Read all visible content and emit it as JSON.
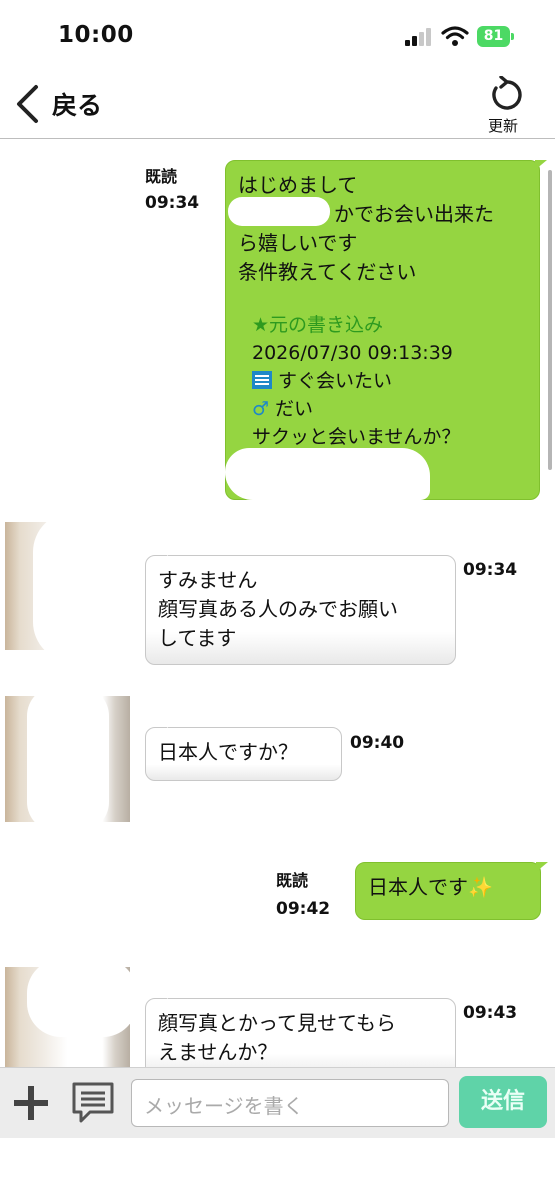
{
  "status_bar": {
    "time": "10:00",
    "battery": "81"
  },
  "nav": {
    "back_label": "戻る",
    "refresh_label": "更新"
  },
  "messages": [
    {
      "direction": "out",
      "read": "既読",
      "time": "09:34",
      "lines": [
        "はじめまして",
        "かでお会い出来た",
        "ら嬉しいです",
        "条件教えてください"
      ],
      "quote": {
        "title": "★元の書き込み",
        "datetime": "2026/07/30 09:13:39",
        "topic": "すぐ会いたい",
        "age": "だい",
        "body": "サクッと会いませんか？"
      }
    },
    {
      "direction": "in",
      "time": "09:34",
      "lines": [
        "すみません",
        "顔写真ある人のみでお願い",
        "してます"
      ]
    },
    {
      "direction": "in",
      "time": "09:40",
      "lines": [
        "日本人ですか？"
      ]
    },
    {
      "direction": "out",
      "read": "既読",
      "time": "09:42",
      "lines": [
        "日本人です"
      ],
      "emoji": "✨"
    },
    {
      "direction": "in",
      "time": "09:43",
      "lines": [
        "顔写真とかって見せてもら",
        "えませんか？"
      ]
    }
  ],
  "composer": {
    "placeholder": "メッセージを書く",
    "send_label": "送信"
  },
  "colors": {
    "out_bubble": "#95d541",
    "send_button": "#5fd3a8",
    "quote_title": "#2e9a1f"
  }
}
